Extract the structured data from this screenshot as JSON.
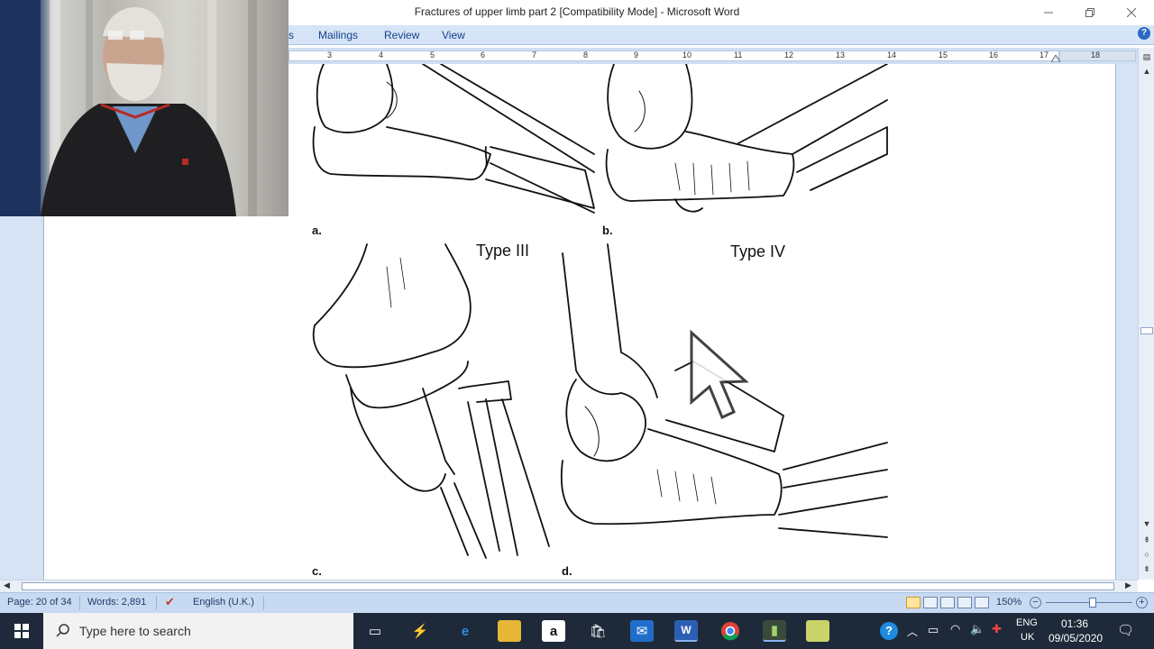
{
  "window": {
    "title": "Fractures of upper limb part 2 [Compatibility Mode] - Microsoft Word"
  },
  "ribbon": {
    "tabs": [
      {
        "label": "s"
      },
      {
        "label": "Mailings"
      },
      {
        "label": "Review"
      },
      {
        "label": "View"
      }
    ]
  },
  "ruler": {
    "numbers": [
      "3",
      "4",
      "5",
      "6",
      "7",
      "8",
      "9",
      "10",
      "11",
      "12",
      "13",
      "14",
      "15",
      "16",
      "17",
      "18"
    ]
  },
  "figure": {
    "labels": {
      "a": "a.",
      "b": "b.",
      "c": "c.",
      "d": "d."
    },
    "type3": "Type III",
    "type4": "Type IV"
  },
  "statusbar": {
    "page": "Page: 20 of 34",
    "words": "Words: 2,891",
    "language": "English (U.K.)",
    "zoom": "150%"
  },
  "taskbar": {
    "search_placeholder": "Type here to search",
    "lang_line1": "ENG",
    "lang_line2": "UK",
    "time": "01:36",
    "date": "09/05/2020"
  },
  "colors": {
    "ribbon_bg": "#d5e4f7",
    "status_bg": "#c7daf2",
    "taskbar_bg": "#1e2a3a",
    "accent": "#15428b"
  },
  "icons": {
    "help": "help-icon",
    "start": "windows-start-icon",
    "search": "search-icon",
    "cursor": "mouse-cursor-icon"
  }
}
